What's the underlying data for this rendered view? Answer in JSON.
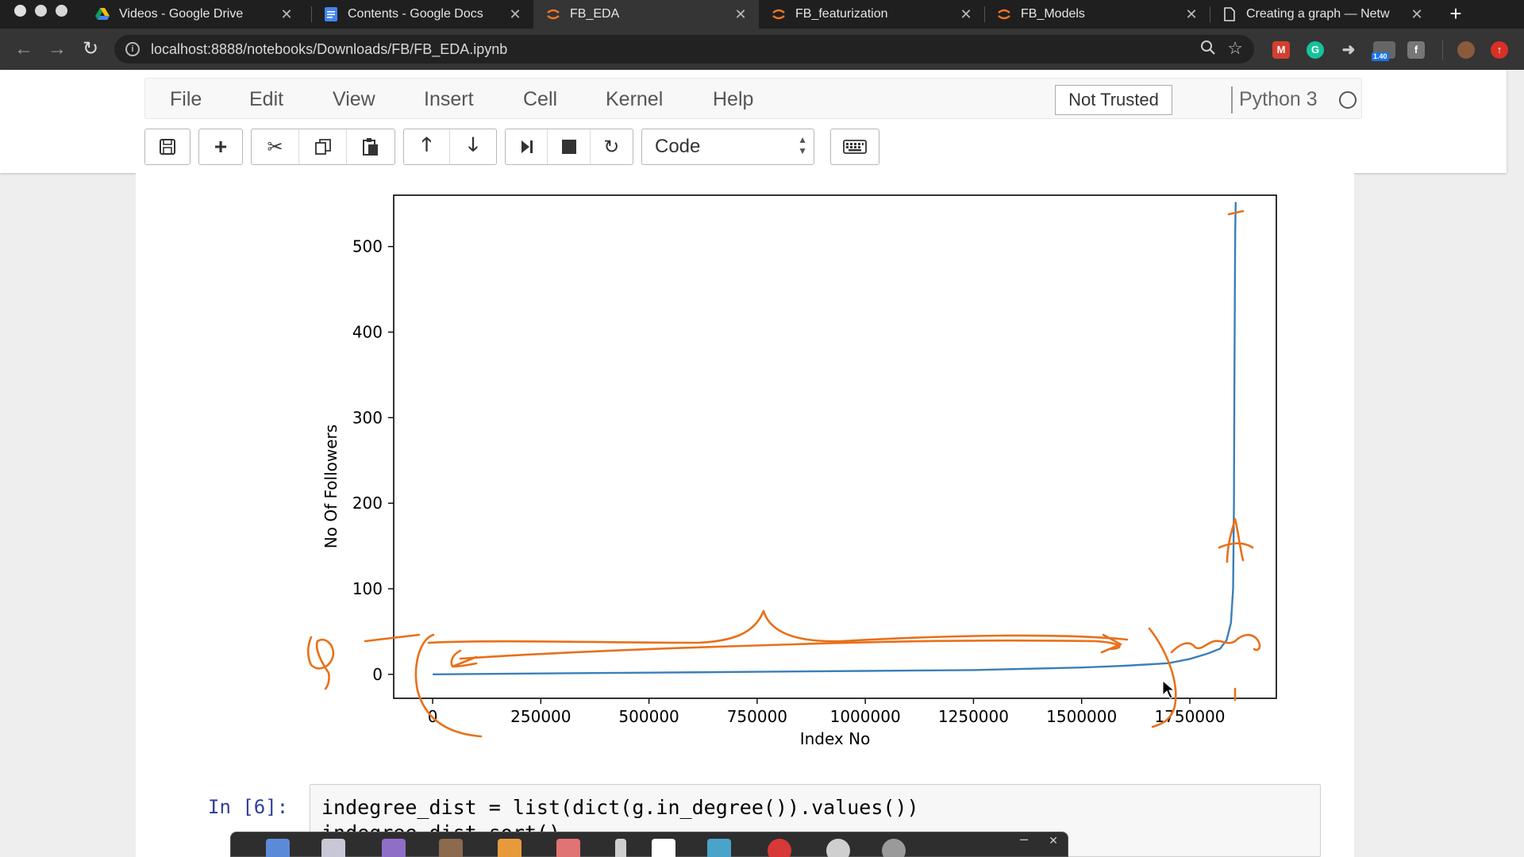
{
  "browser": {
    "tabs": [
      {
        "title": "Videos - Google Drive",
        "icon": "google-drive-icon"
      },
      {
        "title": "Contents - Google Docs",
        "icon": "google-docs-icon"
      },
      {
        "title": "FB_EDA",
        "icon": "jupyter-icon",
        "active": true
      },
      {
        "title": "FB_featurization",
        "icon": "jupyter-icon"
      },
      {
        "title": "FB_Models",
        "icon": "jupyter-icon"
      },
      {
        "title": "Creating a graph — Netw",
        "icon": "document-icon"
      }
    ],
    "url": "localhost:8888/notebooks/Downloads/FB/FB_EDA.ipynb",
    "extension_badge": "1.40"
  },
  "jupyter": {
    "menu": [
      "File",
      "Edit",
      "View",
      "Insert",
      "Cell",
      "Kernel",
      "Help"
    ],
    "trust_label": "Not Trusted",
    "kernel_name": "Python 3",
    "cell_type": "Code"
  },
  "chart_data": {
    "type": "line",
    "title": "",
    "xlabel": "Index No",
    "ylabel": "No Of Followers",
    "xlim": [
      -90000,
      1950000
    ],
    "ylim": [
      -28,
      560
    ],
    "xticks": [
      0,
      250000,
      500000,
      750000,
      1000000,
      1250000,
      1500000,
      1750000
    ],
    "xtick_labels": [
      "0",
      "250000",
      "500000",
      "750000",
      "1000000",
      "1250000",
      "1500000",
      "1750000"
    ],
    "yticks": [
      0,
      100,
      200,
      300,
      400,
      500
    ],
    "ytick_labels": [
      "0",
      "100",
      "200",
      "300",
      "400",
      "500"
    ],
    "series": [
      {
        "color": "#3b7fb8",
        "x": [
          0,
          250000,
          500000,
          750000,
          1000000,
          1250000,
          1500000,
          1600000,
          1700000,
          1750000,
          1790000,
          1820000,
          1835000,
          1845000,
          1850000,
          1852000,
          1853000,
          1854000,
          1855000,
          1856000
        ],
        "y": [
          0,
          1,
          2,
          3,
          4,
          5,
          8,
          10,
          13,
          18,
          24,
          30,
          40,
          60,
          100,
          200,
          330,
          440,
          520,
          552
        ]
      }
    ],
    "grid": false,
    "annotation_color": "#e8701a"
  },
  "code_cell": {
    "prompt": "In [6]:",
    "lines": [
      "indegree_dist = list(dict(g.in_degree()).values())",
      "indegree_dist.sort()"
    ]
  }
}
